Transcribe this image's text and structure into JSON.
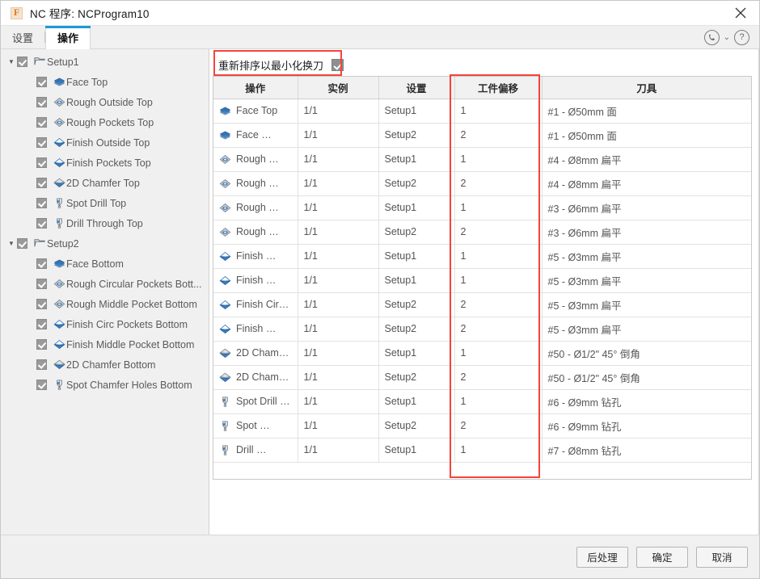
{
  "window": {
    "title": "NC 程序: NCProgram10",
    "app_icon": "fusion-f-icon",
    "close_label": "✕"
  },
  "tabs": [
    {
      "label": "设置",
      "active": false
    },
    {
      "label": "操作",
      "active": true
    }
  ],
  "header_icons": {
    "support": "phone-circle-icon",
    "chevron": "⌄",
    "help": "?"
  },
  "tree": [
    {
      "label": "Setup1",
      "level": 0,
      "icon": "folder-open-icon",
      "checked": true,
      "expanded": true
    },
    {
      "label": "Face Top",
      "level": 1,
      "icon": "face-operation-icon",
      "checked": true
    },
    {
      "label": "Rough Outside Top",
      "level": 1,
      "icon": "adaptive-rough-icon",
      "checked": true
    },
    {
      "label": "Rough Pockets Top",
      "level": 1,
      "icon": "adaptive-rough-icon",
      "checked": true
    },
    {
      "label": "Finish Outside Top",
      "level": 1,
      "icon": "contour-finish-icon",
      "checked": true
    },
    {
      "label": "Finish Pockets Top",
      "level": 1,
      "icon": "contour-finish-icon",
      "checked": true
    },
    {
      "label": "2D Chamfer Top",
      "level": 1,
      "icon": "chamfer-icon",
      "checked": true
    },
    {
      "label": "Spot Drill Top",
      "level": 1,
      "icon": "drill-icon",
      "checked": true
    },
    {
      "label": "Drill Through Top",
      "level": 1,
      "icon": "drill-icon",
      "checked": true
    },
    {
      "label": "Setup2",
      "level": 0,
      "icon": "folder-open-icon",
      "checked": true,
      "expanded": true
    },
    {
      "label": "Face Bottom",
      "level": 1,
      "icon": "face-operation-icon",
      "checked": true
    },
    {
      "label": "Rough Circular Pockets Bott...",
      "level": 1,
      "icon": "adaptive-rough-icon",
      "checked": true
    },
    {
      "label": "Rough Middle Pocket Bottom",
      "level": 1,
      "icon": "adaptive-rough-icon",
      "checked": true
    },
    {
      "label": "Finish Circ Pockets Bottom",
      "level": 1,
      "icon": "contour-finish-icon",
      "checked": true
    },
    {
      "label": "Finish Middle Pocket Bottom",
      "level": 1,
      "icon": "contour-finish-icon",
      "checked": true
    },
    {
      "label": "2D Chamfer Bottom",
      "level": 1,
      "icon": "chamfer-icon",
      "checked": true
    },
    {
      "label": "Spot Chamfer Holes Bottom",
      "level": 1,
      "icon": "drill-icon",
      "checked": true
    }
  ],
  "reorder": {
    "label": "重新排序以最小化换刀",
    "checked": true
  },
  "table": {
    "columns": [
      "操作",
      "实例",
      "设置",
      "工件偏移",
      "刀具"
    ],
    "rows": [
      {
        "operation": "Face Top",
        "icon": "face-operation-icon",
        "instances": "1/1",
        "setup": "Setup1",
        "wcs": "1",
        "tool": "#1 - Ø50mm 面"
      },
      {
        "operation": "Face …",
        "icon": "face-operation-icon",
        "instances": "1/1",
        "setup": "Setup2",
        "wcs": "2",
        "tool": "#1 - Ø50mm 面"
      },
      {
        "operation": "Rough …",
        "icon": "adaptive-rough-icon",
        "instances": "1/1",
        "setup": "Setup1",
        "wcs": "1",
        "tool": "#4 - Ø8mm 扁平"
      },
      {
        "operation": "Rough …",
        "icon": "adaptive-rough-icon",
        "instances": "1/1",
        "setup": "Setup2",
        "wcs": "2",
        "tool": "#4 - Ø8mm 扁平"
      },
      {
        "operation": "Rough …",
        "icon": "adaptive-rough-icon",
        "instances": "1/1",
        "setup": "Setup1",
        "wcs": "1",
        "tool": "#3 - Ø6mm 扁平"
      },
      {
        "operation": "Rough …",
        "icon": "adaptive-rough-icon",
        "instances": "1/1",
        "setup": "Setup2",
        "wcs": "2",
        "tool": "#3 - Ø6mm 扁平"
      },
      {
        "operation": "Finish …",
        "icon": "contour-finish-icon",
        "instances": "1/1",
        "setup": "Setup1",
        "wcs": "1",
        "tool": "#5 - Ø3mm 扁平"
      },
      {
        "operation": "Finish …",
        "icon": "contour-finish-icon",
        "instances": "1/1",
        "setup": "Setup1",
        "wcs": "1",
        "tool": "#5 - Ø3mm 扁平"
      },
      {
        "operation": "Finish Circ …",
        "icon": "contour-finish-icon",
        "instances": "1/1",
        "setup": "Setup2",
        "wcs": "2",
        "tool": "#5 - Ø3mm 扁平"
      },
      {
        "operation": "Finish …",
        "icon": "contour-finish-icon",
        "instances": "1/1",
        "setup": "Setup2",
        "wcs": "2",
        "tool": "#5 - Ø3mm 扁平"
      },
      {
        "operation": "2D Chamfe…",
        "icon": "chamfer-icon",
        "instances": "1/1",
        "setup": "Setup1",
        "wcs": "1",
        "tool": "#50 - Ø1/2\" 45° 倒角"
      },
      {
        "operation": "2D Chamfe…",
        "icon": "chamfer-icon",
        "instances": "1/1",
        "setup": "Setup2",
        "wcs": "2",
        "tool": "#50 - Ø1/2\" 45° 倒角"
      },
      {
        "operation": "Spot Drill …",
        "icon": "drill-icon",
        "instances": "1/1",
        "setup": "Setup1",
        "wcs": "1",
        "tool": "#6 - Ø9mm 钻孔"
      },
      {
        "operation": "Spot …",
        "icon": "drill-icon",
        "instances": "1/1",
        "setup": "Setup2",
        "wcs": "2",
        "tool": "#6 - Ø9mm 钻孔"
      },
      {
        "operation": "Drill …",
        "icon": "drill-icon",
        "instances": "1/1",
        "setup": "Setup1",
        "wcs": "1",
        "tool": "#7 - Ø8mm 钻孔"
      }
    ]
  },
  "footer": {
    "post_process": "后处理",
    "ok": "确定",
    "cancel": "取消"
  },
  "colors": {
    "accent": "#1a9bd7",
    "highlight": "#f4433c",
    "icon_blue": "#3d7fc1"
  }
}
